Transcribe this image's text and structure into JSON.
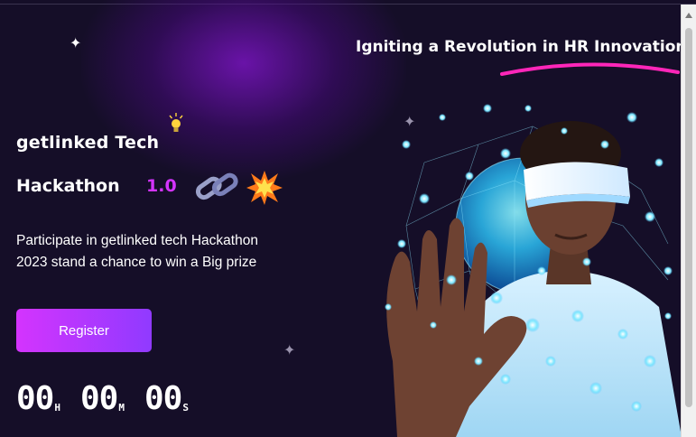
{
  "hero": {
    "tagline": "Igniting a Revolution in HR Innovation",
    "logo_text": "getlinked Tech",
    "title": "Hackathon",
    "version": "1.0",
    "description": "Participate in getlinked tech Hackathon 2023 stand a chance to win a Big prize",
    "register_label": "Register"
  },
  "countdown": [
    {
      "value": "00",
      "unit": "H"
    },
    {
      "value": "00",
      "unit": "M"
    },
    {
      "value": "00",
      "unit": "S"
    }
  ],
  "icons": [
    "star-sparkle-icon",
    "lightbulb-icon",
    "chain-link-icon",
    "explosion-icon"
  ],
  "colors": {
    "background": "#150e28",
    "accent_pink": "#d434fe",
    "accent_purple": "#903aff",
    "underline_pink": "#ff26b9"
  }
}
